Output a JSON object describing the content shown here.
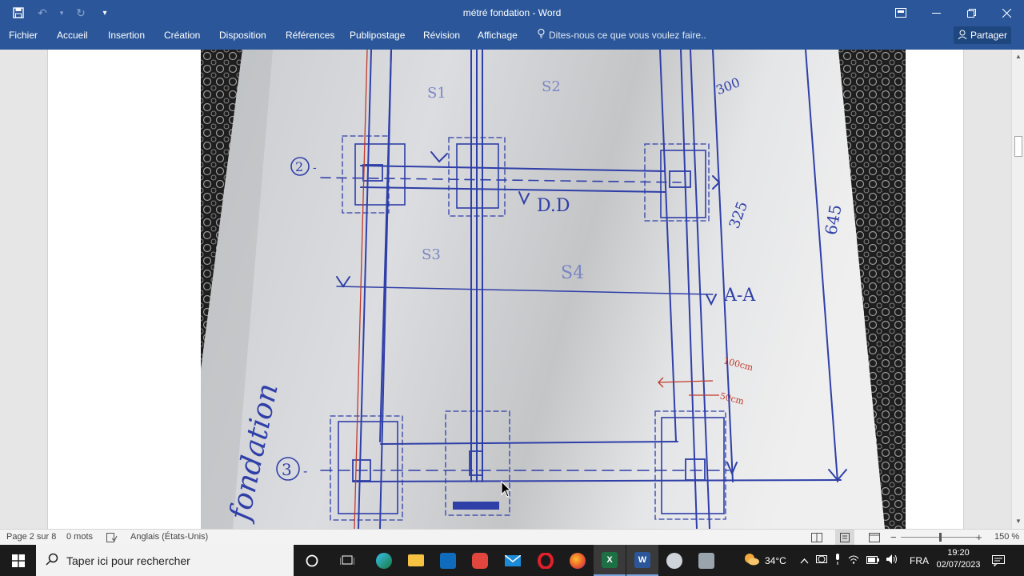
{
  "window": {
    "title": "métré fondation - Word",
    "quick_access": [
      "save-icon",
      "undo-icon",
      "redo-icon",
      "customize-qat-icon"
    ],
    "controls": [
      "ribbon-display-icon",
      "minimize-icon",
      "restore-icon",
      "close-icon"
    ]
  },
  "ribbon": {
    "tabs": [
      "Fichier",
      "Accueil",
      "Insertion",
      "Création",
      "Disposition",
      "Références",
      "Publipostage",
      "Révision",
      "Affichage"
    ],
    "tell_me": "Dites-nous ce que vous voulez faire..",
    "share": "Partager"
  },
  "document": {
    "image_annotations": {
      "circle_2": "2",
      "circle_3": "3",
      "s1": "S1",
      "s2": "S2",
      "s3": "S3",
      "s4": "S4",
      "dd": "D.D",
      "aa": "A-A",
      "dim_300": "300",
      "dim_325": "325",
      "dim_645": "645",
      "dim_100cm": "100cm",
      "dim_50cm": "50cm",
      "fondation": "fondation"
    }
  },
  "statusbar": {
    "page": "Page 2 sur 8",
    "words": "0 mots",
    "language": "Anglais (États-Unis)",
    "zoom": "150 %",
    "zoom_level_percent": 150
  },
  "taskbar": {
    "search_placeholder": "Taper ici pour rechercher",
    "apps": [
      "cortana-icon",
      "task-view-icon",
      "edge-icon",
      "file-explorer-icon",
      "store-icon",
      "opera-gx-icon",
      "mail-icon",
      "opera-icon",
      "firefox-icon",
      "excel-icon",
      "word-icon",
      "app-icon",
      "app-icon-2"
    ],
    "weather": "34°C",
    "language": "FRA",
    "time": "19:20",
    "date": "02/07/2023"
  },
  "colors": {
    "word_blue": "#2b579a",
    "ink_blue": "#2f3fa8",
    "ink_red": "#c0392b"
  }
}
